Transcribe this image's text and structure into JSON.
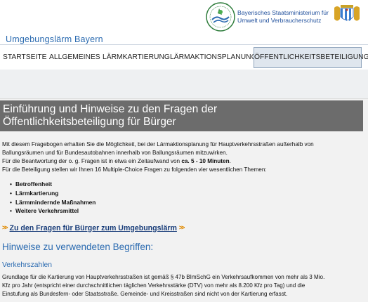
{
  "header": {
    "ministry_name_line1": "Bayerisches Staatsministerium für",
    "ministry_name_line2": "Umwelt und Verbraucherschutz",
    "logo_icon": "stmuv-circular-logo-icon",
    "coat_of_arms_icon": "bavarian-coat-of-arms-icon"
  },
  "site": {
    "title": "Umgebungslärm Bayern"
  },
  "nav": {
    "items": [
      {
        "label": "STARTSEITE"
      },
      {
        "label": "ALLGEMEINES"
      },
      {
        "label": "LÄRMKARTIERUNG"
      },
      {
        "label": "LÄRMAKTIONSPLANUNG"
      },
      {
        "label": "ÖFFENTLICHKEITSBETEILIGUNG",
        "active": true
      }
    ]
  },
  "main": {
    "hero_line1": "Einführung und Hinweise zu den Fragen der",
    "hero_line2": "Öffentlichkeitsbeteiligung für Bürger",
    "intro_line1": "Mit diesem Fragebogen erhalten Sie die Möglichkeit, bei der Lärmaktionsplanung für Hauptverkehrsstraßen außerhalb von",
    "intro_line2": "Ballungsräumen und für Bundesautobahnen innerhalb von Ballungsräumen mitzuwirken.",
    "intro_line3_pre": "Für die Beantwortung der o. g. Fragen ist in etwa ein Zeitaufwand von ",
    "intro_line3_bold": "ca. 5 - 10 Minuten",
    "intro_line3_post": ".",
    "intro_line4": "Für die Beteiligung stellen wir Ihnen 16 Multiple-Choice Fragen zu folgenden vier wesentlichen Themen:",
    "topics": [
      "Betroffenheit",
      "Lärmkartierung",
      "Lärmmindernde Maßnahmen",
      "Weitere Verkehrsmittel"
    ],
    "questions_link": "Zu den Fragen für Bürger zum Umgebungslärm",
    "arrow_left": ">>",
    "arrow_right": ">>",
    "terms_heading": "Hinweise zu verwendeten Begriffen:",
    "verkehr_heading": "Verkehrszahlen",
    "verkehr_line1": "Grundlage für die Kartierung von Hauptverkehrsstraßen ist gemäß § 47b BImSchG ein Verkehrsaufkommen von mehr als 3 Mio.",
    "verkehr_line2": "Kfz pro Jahr (entspricht einer durchschnittlichen täglichen Verkehrsstärke (DTV) von mehr als 8.200 Kfz pro Tag) und die",
    "verkehr_line3": "Einstufung als Bundesfern- oder Staatsstraße. Gemeinde- und Kreisstraßen sind nicht von der Kartierung erfasst."
  },
  "colors": {
    "brand_blue": "#2a6ab0",
    "hero_gray": "#6c6c6c",
    "link_orange": "#e08a00",
    "link_blue": "#1a3e7a"
  }
}
